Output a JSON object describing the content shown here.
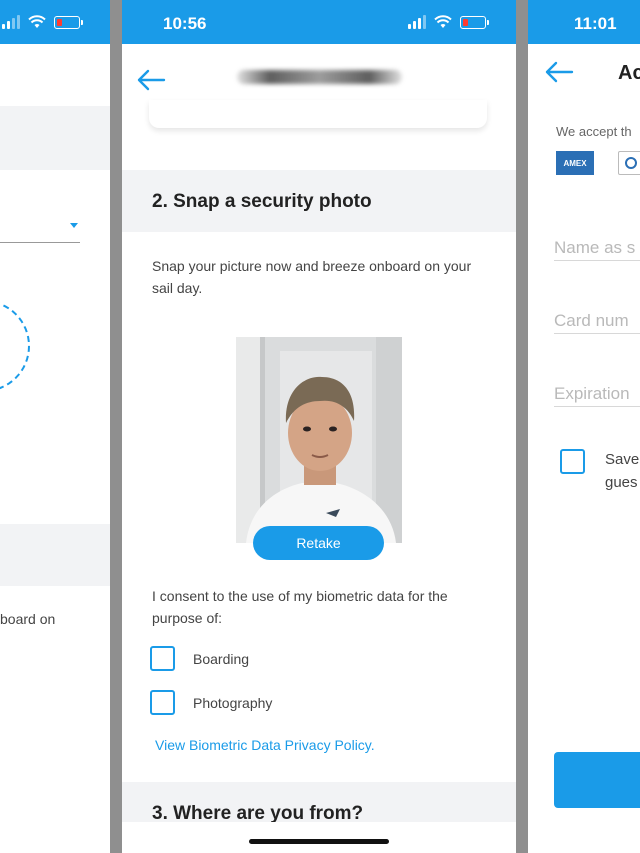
{
  "left_screen": {
    "status": {
      "battery_color": "#ff3b30"
    },
    "partial_text": "board on"
  },
  "center_screen": {
    "status": {
      "time": "10:56"
    },
    "header": {
      "back_icon": "arrow-left-icon",
      "title_redacted": true
    },
    "section2": {
      "title": "2. Snap a security photo",
      "description": "Snap your picture now and breeze onboard on your sail day.",
      "retake_label": "Retake"
    },
    "consent": {
      "text": "I consent to the use of my biometric data for the purpose of:",
      "options": [
        {
          "label": "Boarding",
          "checked": false
        },
        {
          "label": "Photography",
          "checked": false
        }
      ],
      "privacy_link": "View Biometric Data Privacy Policy."
    },
    "section3": {
      "title": "3. Where are you from?"
    }
  },
  "right_screen": {
    "status": {
      "time": "11:01"
    },
    "header": {
      "title_partial": "Ac"
    },
    "accept_text": "We accept th",
    "amex_label": "AMEX",
    "fields": [
      {
        "placeholder": "Name as s"
      },
      {
        "placeholder": "Card num"
      },
      {
        "placeholder": "Expiration"
      }
    ],
    "save_text_line1": "Save",
    "save_text_line2": "gues"
  },
  "colors": {
    "accent": "#1a9be8",
    "section_bg": "#f2f3f5",
    "text": "#444444"
  }
}
